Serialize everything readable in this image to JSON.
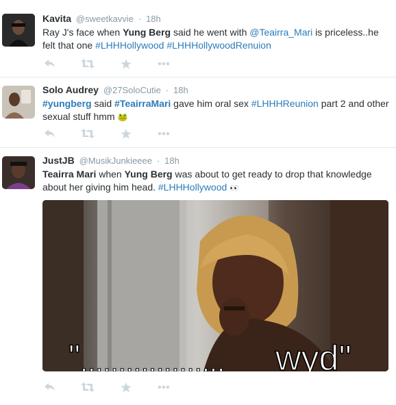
{
  "tweets": [
    {
      "name": "Kavita",
      "handle": "@sweetkavvie",
      "dot": "·",
      "time": "18h",
      "parts": {
        "p1": "Ray J's face when ",
        "p2": "Yung Berg",
        "p3": " said he went with ",
        "p4": "@Teairra_Mari",
        "p5": " is priceless..he felt that one ",
        "p6": "#LHHHollywood",
        "p7": " ",
        "p8": "#LHHHollywoodRenuion"
      }
    },
    {
      "name": "Solo Audrey",
      "handle": "@27SoloCutie",
      "dot": "·",
      "time": "18h",
      "parts": {
        "p1": "#yungberg",
        "p2": " said ",
        "p3": "#TeairraMari",
        "p4": " gave him oral sex ",
        "p5": "#LHHHReunion",
        "p6": " part 2 and other sexual stuff hmm ",
        "emoji": "🐸"
      }
    },
    {
      "name": "JustJB",
      "handle": "@MusikJunkieeee",
      "dot": "·",
      "time": "18h",
      "parts": {
        "p1": "Teairra Mari",
        "p2": " when ",
        "p3": "Yung Berg",
        "p4": " was about to get ready to drop that knowledge about her giving him head. ",
        "p5": "#LHHHollywood",
        "emoji": "👀"
      },
      "media_caption": "\"",
      "media_caption_close": "wyd\"",
      "media_caption_dots": "..................."
    }
  ],
  "actions": {
    "reply_icon": "reply-icon",
    "retweet_icon": "retweet-icon",
    "favorite_icon": "star-icon",
    "more_icon": "more-icon"
  },
  "colors": {
    "link": "#2b7bb9",
    "muted": "#8899a6",
    "action": "#ccd6dd"
  }
}
